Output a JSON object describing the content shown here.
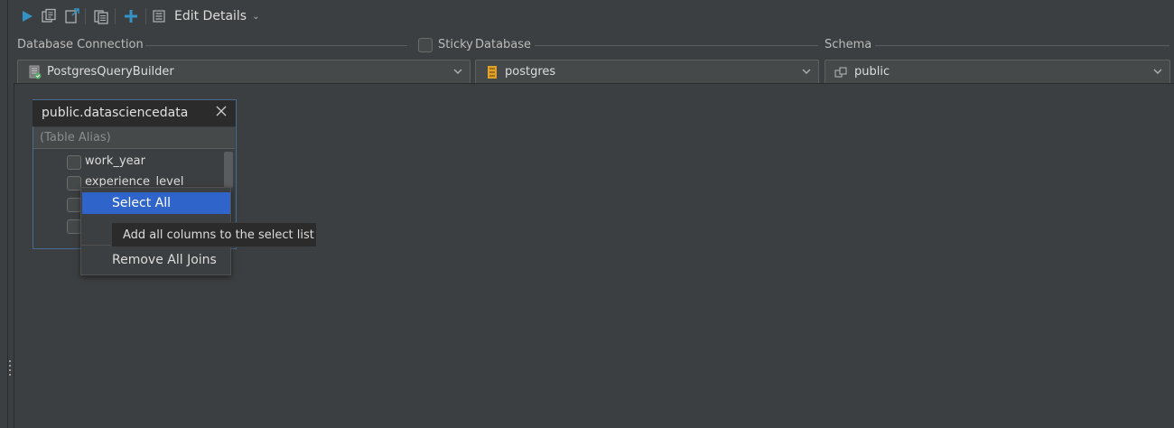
{
  "toolbar": {
    "edit_details_label": "Edit Details",
    "icons": [
      "run-icon",
      "copy-query-icon",
      "new-query-icon",
      "paste-icon",
      "add-icon",
      "details-icon",
      "chevron-down-icon"
    ]
  },
  "connection": {
    "label": "Database Connection",
    "value": "PostgresQueryBuilder"
  },
  "sticky": {
    "label": "Sticky",
    "checked": false
  },
  "database": {
    "label": "Database",
    "value": "postgres"
  },
  "schema": {
    "label": "Schema",
    "value": "public"
  },
  "table_widget": {
    "title": "public.datasciencedata",
    "alias_placeholder": "(Table Alias)",
    "columns": [
      "work_year",
      "experience_level"
    ]
  },
  "context_menu": {
    "items": [
      "Select All",
      "Remove All Joins"
    ],
    "selected_item": "Select All"
  },
  "tooltip": {
    "text": "Add all columns to the select list"
  },
  "colors": {
    "background": "#3c3f41",
    "accent": "#2f65ca",
    "play": "#3592c4",
    "add": "#3592c4"
  }
}
